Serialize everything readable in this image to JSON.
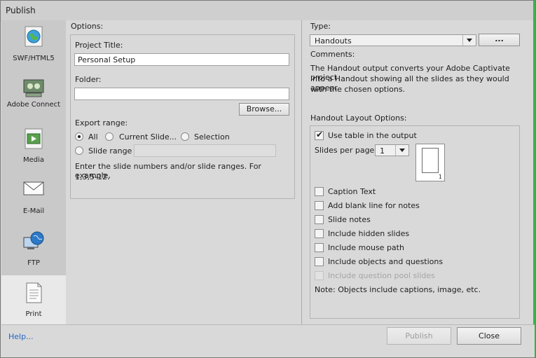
{
  "window": {
    "title": "Publish"
  },
  "sidebar": {
    "items": [
      {
        "label": "SWF/HTML5",
        "icon": "globe-icon",
        "selected": false
      },
      {
        "label": "Adobe Connect",
        "icon": "adobe-connect-icon",
        "selected": false
      },
      {
        "label": "Media",
        "icon": "film-icon",
        "selected": false
      },
      {
        "label": "E-Mail",
        "icon": "envelope-icon",
        "selected": false
      },
      {
        "label": "FTP",
        "icon": "ftp-globe-icon",
        "selected": false
      },
      {
        "label": "Print",
        "icon": "document-icon",
        "selected": true
      }
    ]
  },
  "options": {
    "header": "Options:",
    "project_title_label": "Project Title:",
    "project_title_value": "Personal Setup",
    "folder_label": "Folder:",
    "folder_value": "",
    "browse_label": "Browse...",
    "export_range_label": "Export range:",
    "radio_all": "All",
    "radio_current": "Current Slide...",
    "radio_selection": "Selection",
    "radio_slide_range": "Slide range",
    "selected_range": "All",
    "hint_line1": "Enter the slide numbers and/or slide ranges. For example,",
    "hint_line2": "1,3,5-12."
  },
  "type": {
    "label": "Type:",
    "value": "Handouts",
    "more_label": "...",
    "comments_label": "Comments:",
    "comments_line1": "The Handout output converts your Adobe Captivate project",
    "comments_line2": "into a Handout showing all the slides as they would appear",
    "comments_line3": "with the chosen options."
  },
  "handout": {
    "header": "Handout Layout Options:",
    "use_table_label": "Use table in the output",
    "use_table_checked": true,
    "slides_per_page_label": "Slides per page",
    "slides_per_page_value": "1",
    "page_preview_number": "1",
    "checkboxes": [
      {
        "label": "Caption Text",
        "checked": false,
        "disabled": false
      },
      {
        "label": "Add blank line for notes",
        "checked": false,
        "disabled": false
      },
      {
        "label": "Slide notes",
        "checked": false,
        "disabled": false
      },
      {
        "label": "Include hidden slides",
        "checked": false,
        "disabled": false
      },
      {
        "label": "Include mouse path",
        "checked": false,
        "disabled": false
      },
      {
        "label": "Include objects and questions",
        "checked": false,
        "disabled": false
      },
      {
        "label": "Include question pool slides",
        "checked": false,
        "disabled": true
      }
    ],
    "note": "Note: Objects include captions, image, etc."
  },
  "footer": {
    "help_label": "Help...",
    "publish_label": "Publish",
    "publish_enabled": false,
    "close_label": "Close"
  }
}
